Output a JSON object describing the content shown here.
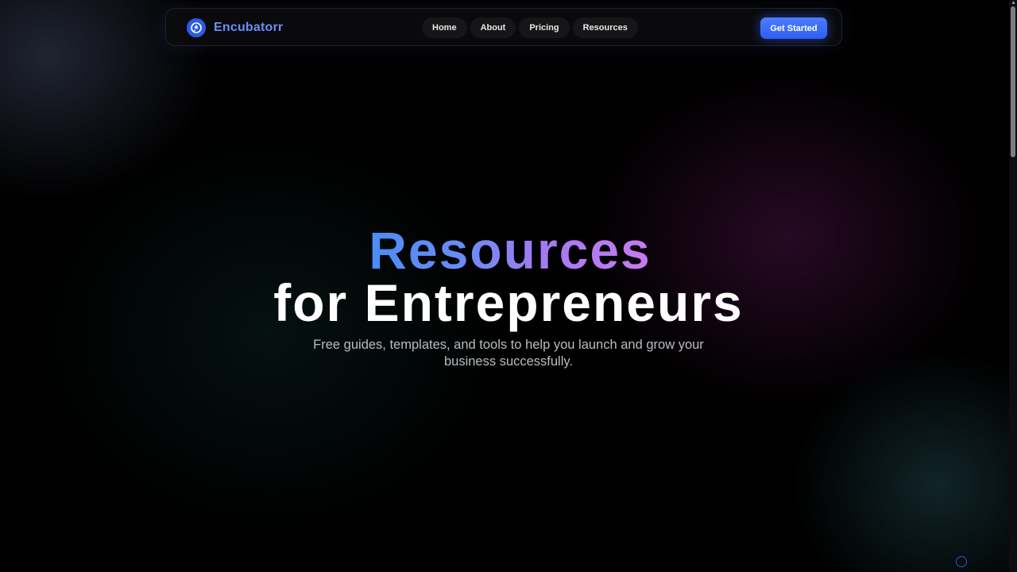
{
  "brand": {
    "name": "Encubatorr",
    "logo_icon": "rocket-icon",
    "accent": "#6c8cf5"
  },
  "nav": {
    "links": [
      {
        "label": "Home"
      },
      {
        "label": "About"
      },
      {
        "label": "Pricing"
      },
      {
        "label": "Resources"
      }
    ],
    "cta_label": "Get Started"
  },
  "hero": {
    "title_gradient": "Resources",
    "title_plain": "for Entrepreneurs",
    "subtitle": "Free guides, templates, and tools to help you launch and grow your business successfully."
  },
  "colors": {
    "primary": "#2e5ef2",
    "gradient_start": "#4a8cf5",
    "gradient_end": "#c77bf0",
    "background": "#000000"
  }
}
